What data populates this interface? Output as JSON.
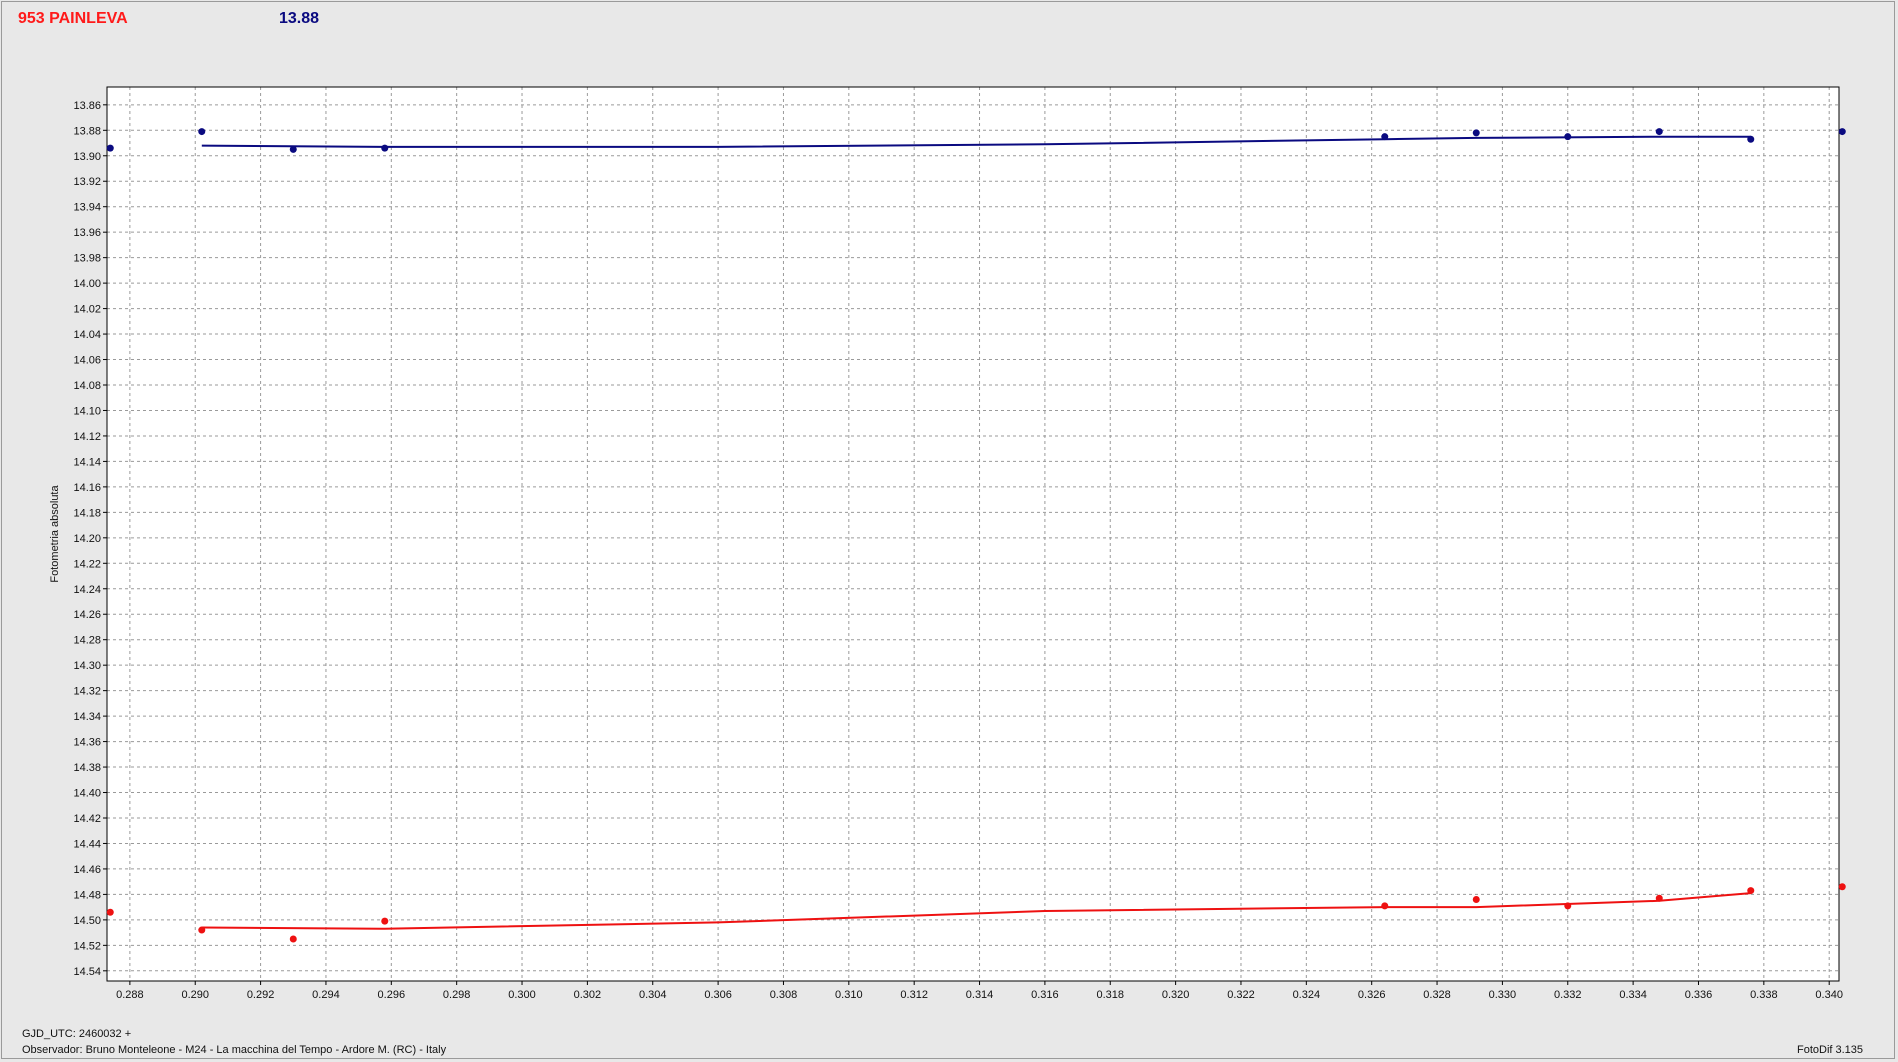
{
  "header": {
    "title": "953 PAINLEVA",
    "value": "13.88"
  },
  "footer": {
    "gjd": "GJD_UTC: 2460032 +",
    "observer": "Observador: Bruno Monteleone - M24 - La macchina del Tempo - Ardore M. (RC) - Italy",
    "software": "FotoDif 3.135"
  },
  "chart_data": {
    "type": "scatter",
    "ylabel": "Fotometria absoluta",
    "xlabel": "",
    "xlim": [
      0.2873,
      0.3403
    ],
    "ylim": [
      13.846,
      14.548
    ],
    "y_inverted": true,
    "grid": true,
    "x_ticks": [
      "0.288",
      "0.290",
      "0.292",
      "0.294",
      "0.296",
      "0.298",
      "0.300",
      "0.302",
      "0.304",
      "0.306",
      "0.308",
      "0.310",
      "0.312",
      "0.314",
      "0.316",
      "0.318",
      "0.320",
      "0.322",
      "0.324",
      "0.326",
      "0.328",
      "0.330",
      "0.332",
      "0.334",
      "0.336",
      "0.338",
      "0.340"
    ],
    "y_ticks": [
      "13.86",
      "13.88",
      "13.90",
      "13.92",
      "13.94",
      "13.96",
      "13.98",
      "14.00",
      "14.02",
      "14.04",
      "14.06",
      "14.08",
      "14.10",
      "14.12",
      "14.14",
      "14.16",
      "14.18",
      "14.20",
      "14.22",
      "14.24",
      "14.26",
      "14.28",
      "14.30",
      "14.32",
      "14.34",
      "14.36",
      "14.38",
      "14.40",
      "14.42",
      "14.44",
      "14.46",
      "14.48",
      "14.50",
      "14.52",
      "14.54"
    ],
    "series": [
      {
        "color": "#0a0a80",
        "points": [
          [
            0.2874,
            13.894
          ],
          [
            0.2902,
            13.881
          ],
          [
            0.293,
            13.895
          ],
          [
            0.2958,
            13.894
          ],
          [
            0.3264,
            13.885
          ],
          [
            0.3292,
            13.882
          ],
          [
            0.332,
            13.885
          ],
          [
            0.3348,
            13.881
          ],
          [
            0.3376,
            13.887
          ],
          [
            0.3404,
            13.881
          ]
        ],
        "trend": [
          [
            0.2902,
            13.892
          ],
          [
            0.2958,
            13.893
          ],
          [
            0.306,
            13.893
          ],
          [
            0.316,
            13.891
          ],
          [
            0.3264,
            13.887
          ],
          [
            0.3292,
            13.886
          ],
          [
            0.3348,
            13.885
          ],
          [
            0.3376,
            13.885
          ]
        ]
      },
      {
        "color": "#ee1111",
        "points": [
          [
            0.2874,
            14.494
          ],
          [
            0.2902,
            14.508
          ],
          [
            0.293,
            14.515
          ],
          [
            0.2958,
            14.501
          ],
          [
            0.3264,
            14.489
          ],
          [
            0.3292,
            14.484
          ],
          [
            0.332,
            14.489
          ],
          [
            0.3348,
            14.483
          ],
          [
            0.3376,
            14.477
          ],
          [
            0.3404,
            14.474
          ]
        ],
        "trend": [
          [
            0.2902,
            14.506
          ],
          [
            0.2958,
            14.507
          ],
          [
            0.306,
            14.502
          ],
          [
            0.316,
            14.493
          ],
          [
            0.3264,
            14.49
          ],
          [
            0.3292,
            14.49
          ],
          [
            0.3348,
            14.485
          ],
          [
            0.3376,
            14.479
          ]
        ]
      }
    ]
  }
}
